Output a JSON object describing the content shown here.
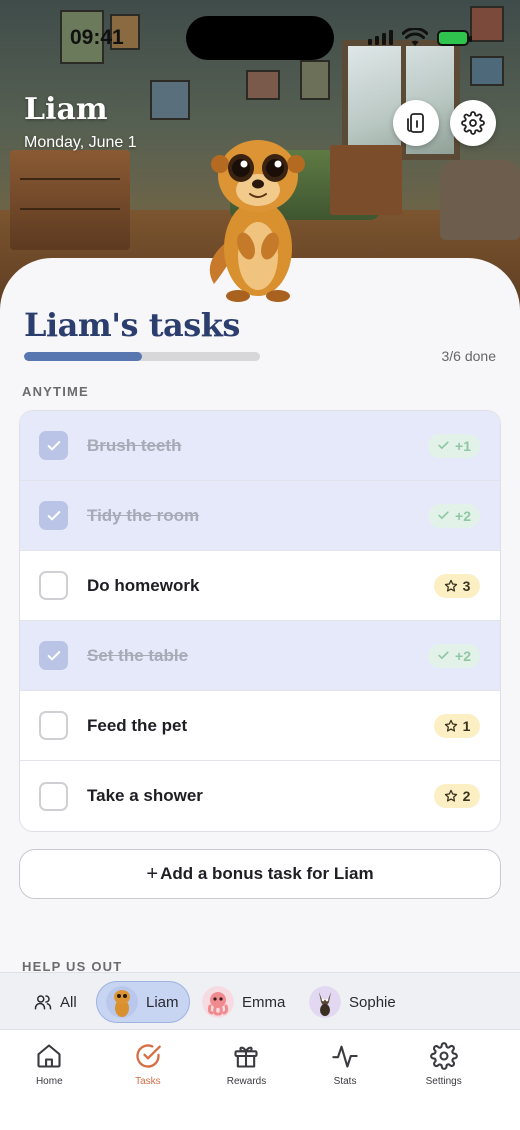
{
  "status_bar": {
    "time": "09:41"
  },
  "header": {
    "kid_name": "Liam",
    "date": "Monday, June 1"
  },
  "buttons": {
    "switch_device": "switch-device",
    "settings": "settings"
  },
  "tasks": {
    "title": "Liam's tasks",
    "progress_fraction": 0.5,
    "done_label": "3/6 done",
    "section_anytime": "ANYTIME",
    "items": [
      {
        "label": "Brush teeth",
        "done": true,
        "points": "+1"
      },
      {
        "label": "Tidy the room",
        "done": true,
        "points": "+2"
      },
      {
        "label": "Do homework",
        "done": false,
        "points": "3"
      },
      {
        "label": "Set the table",
        "done": true,
        "points": "+2"
      },
      {
        "label": "Feed the pet",
        "done": false,
        "points": "1"
      },
      {
        "label": "Take a shower",
        "done": false,
        "points": "2"
      }
    ],
    "bonus_button": "Add a bonus task for Liam",
    "bonus_plus": "+",
    "section_help": "HELP US OUT"
  },
  "kid_filter": [
    {
      "label": "All",
      "active": false
    },
    {
      "label": "Liam",
      "active": true
    },
    {
      "label": "Emma",
      "active": false
    },
    {
      "label": "Sophie",
      "active": false
    }
  ],
  "bottom_nav": [
    {
      "label": "Home",
      "icon": "home-icon",
      "active": false
    },
    {
      "label": "Tasks",
      "icon": "check-circle-icon",
      "active": true
    },
    {
      "label": "Rewards",
      "icon": "gift-icon",
      "active": false
    },
    {
      "label": "Stats",
      "icon": "activity-icon",
      "active": false
    },
    {
      "label": "Settings",
      "icon": "gear-icon",
      "active": false
    }
  ],
  "colors": {
    "accent": "#d66f46",
    "title": "#2b3e6e",
    "progress": "#5877b0",
    "done_row": "#e6e9f9",
    "pending_pill": "#fbefc3",
    "earned_pill": "#e3f2e9"
  }
}
